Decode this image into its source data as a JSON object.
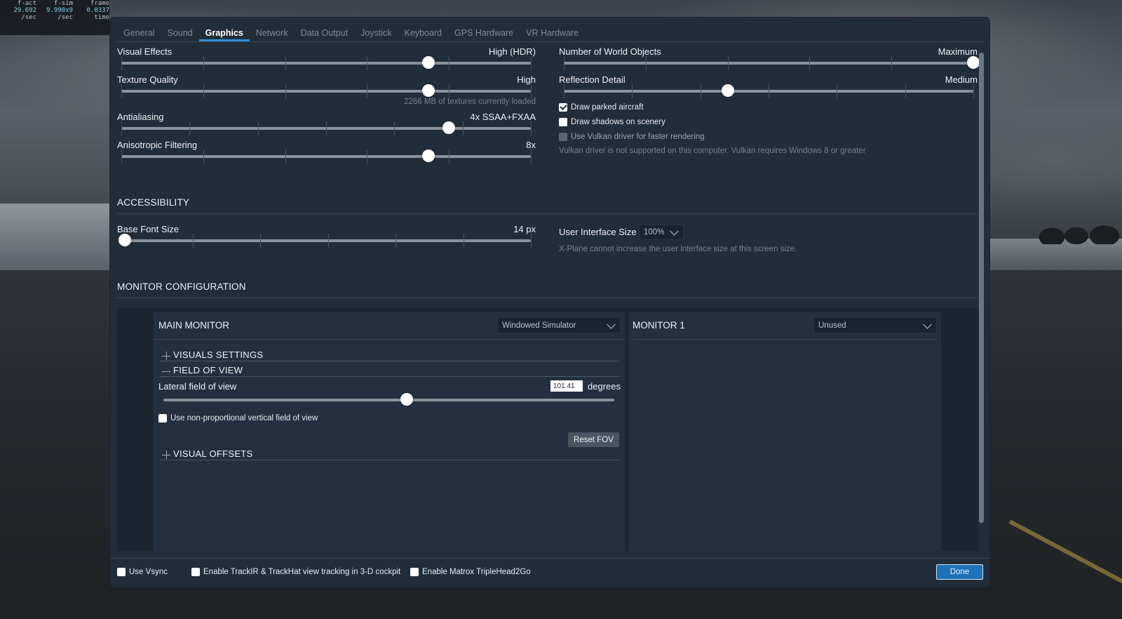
{
  "fps": {
    "headers": [
      "f-act",
      "f-sim",
      "frame"
    ],
    "values": [
      "29.692",
      "9.990x9",
      "0.0337"
    ],
    "units": [
      "/sec",
      "/sec",
      "time"
    ]
  },
  "tabs": [
    "General",
    "Sound",
    "Graphics",
    "Network",
    "Data Output",
    "Joystick",
    "Keyboard",
    "GPS Hardware",
    "VR Hardware"
  ],
  "active_tab": "Graphics",
  "graphics": {
    "visual_effects": {
      "label": "Visual Effects",
      "value": "High (HDR)",
      "level": 0.75
    },
    "texture_quality": {
      "label": "Texture Quality",
      "value": "High",
      "level": 0.75,
      "note": "2266 MB of textures currently loaded"
    },
    "antialiasing": {
      "label": "Antialiasing",
      "value": "4x SSAA+FXAA",
      "level": 0.8
    },
    "anisotropic": {
      "label": "Anisotropic Filtering",
      "value": "8x",
      "level": 0.75
    },
    "world_objects": {
      "label": "Number of World Objects",
      "value": "Maximum",
      "level": 1.0
    },
    "reflection": {
      "label": "Reflection Detail",
      "value": "Medium",
      "level": 0.4
    },
    "draw_parked": {
      "label": "Draw parked aircraft",
      "checked": true
    },
    "draw_shadows": {
      "label": "Draw shadows on scenery",
      "checked": false
    },
    "use_vulkan": {
      "label": "Use Vulkan driver for faster rendering",
      "checked": false,
      "disabled": true
    },
    "vulkan_note": "Vulkan driver is not supported on this computer. Vulkan requires Windows 8 or greater"
  },
  "accessibility": {
    "title": "ACCESSIBILITY",
    "base_font": {
      "label": "Base Font Size",
      "value": "14 px",
      "level": 0.0
    },
    "ui_size": {
      "label": "User Interface Size",
      "value": "100%"
    },
    "ui_note": "X-Plane cannot increase the user interface size at this screen size."
  },
  "monitor": {
    "title": "MONITOR CONFIGURATION",
    "main": {
      "title": "MAIN MONITOR",
      "mode": "Windowed Simulator",
      "visuals_settings": "VISUALS SETTINGS",
      "field_of_view": "FIELD OF VIEW",
      "lateral_label": "Lateral field of view",
      "lateral_value": "101.41",
      "lateral_unit": "degrees",
      "lateral_level": 0.54,
      "non_proportional": {
        "label": "Use non-proportional vertical field of view",
        "checked": false
      },
      "reset_fov": "Reset FOV",
      "visual_offsets": "VISUAL OFFSETS"
    },
    "monitor1": {
      "title": "MONITOR 1",
      "mode": "Unused"
    }
  },
  "footer": {
    "vsync": {
      "label": "Use Vsync",
      "checked": false
    },
    "trackir": {
      "label": "Enable TrackIR & TrackHat view tracking in 3-D cockpit",
      "checked": false
    },
    "matrox": {
      "label": "Enable Matrox TripleHead2Go",
      "checked": false
    },
    "done": "Done"
  },
  "colors": {
    "accent": "#2f8fd6",
    "panel": "#222d3a",
    "done_button": "#1d72b8"
  }
}
